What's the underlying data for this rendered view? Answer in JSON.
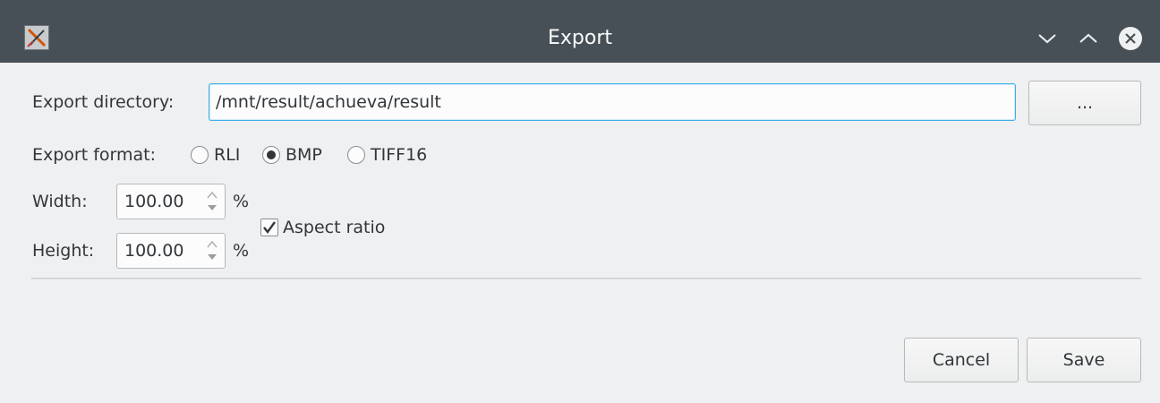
{
  "window": {
    "title": "Export",
    "app_icon": "app-x-icon",
    "controls": [
      "minimize-icon",
      "maximize-icon",
      "close-icon"
    ]
  },
  "directory": {
    "label": "Export directory:",
    "value": "/mnt/result/achueva/result",
    "browse_label": "..."
  },
  "format": {
    "label": "Export format:",
    "options": [
      {
        "label": "RLI",
        "checked": false
      },
      {
        "label": "BMP",
        "checked": true
      },
      {
        "label": "TIFF16",
        "checked": false
      }
    ]
  },
  "size": {
    "width_label": "Width:",
    "width_value": "100.00",
    "width_unit": "%",
    "height_label": "Height:",
    "height_value": "100.00",
    "height_unit": "%",
    "aspect_ratio_label": "Aspect ratio",
    "aspect_ratio_checked": true
  },
  "buttons": {
    "cancel_label": "Cancel",
    "save_label": "Save"
  },
  "colors": {
    "titlebar": "#475057",
    "window_bg": "#eff0f1",
    "focus_accent": "#3daee9",
    "text": "#31363b"
  }
}
